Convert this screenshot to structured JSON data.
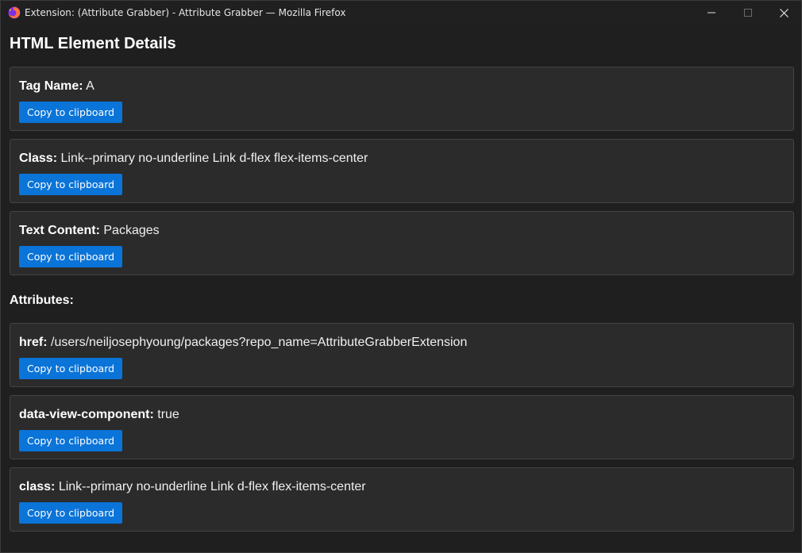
{
  "window": {
    "title": "Extension: (Attribute Grabber) - Attribute Grabber — Mozilla Firefox"
  },
  "page": {
    "title": "HTML Element Details",
    "attributes_heading": "Attributes:"
  },
  "details": [
    {
      "label": "Tag Name:",
      "value": "A",
      "button": "Copy to clipboard"
    },
    {
      "label": "Class:",
      "value": "Link--primary no-underline Link d-flex flex-items-center",
      "button": "Copy to clipboard"
    },
    {
      "label": "Text Content:",
      "value": "Packages",
      "button": "Copy to clipboard"
    }
  ],
  "attributes": [
    {
      "label": "href:",
      "value": "/users/neiljosephyoung/packages?repo_name=AttributeGrabberExtension",
      "button": "Copy to clipboard"
    },
    {
      "label": "data-view-component:",
      "value": "true",
      "button": "Copy to clipboard"
    },
    {
      "label": "class:",
      "value": "Link--primary no-underline Link d-flex flex-items-center",
      "button": "Copy to clipboard"
    }
  ],
  "colors": {
    "button": "#0a74d8",
    "card_bg": "#2b2b2b",
    "page_bg": "#1f1f1f"
  },
  "icons": {
    "app": "firefox-icon",
    "minimize": "minimize-icon",
    "maximize": "maximize-icon",
    "close": "close-icon"
  }
}
